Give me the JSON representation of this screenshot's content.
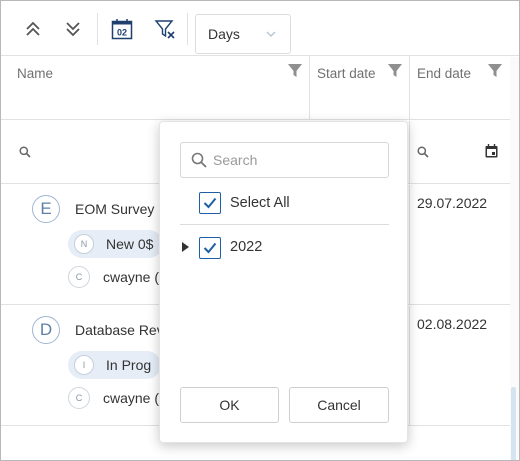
{
  "toolbar": {
    "collapse_all_icon": "double-chevron-up-icon",
    "expand_all_icon": "double-chevron-down-icon",
    "calendar_badge": "02",
    "clear_filter_icon": "filter-clear-icon",
    "scale_select": {
      "value": "Days"
    }
  },
  "columns": [
    {
      "label": "Name"
    },
    {
      "label": "Start date"
    },
    {
      "label": "End date"
    }
  ],
  "rows": [
    {
      "initial": "E",
      "title": "EOM Survey",
      "status_initial": "N",
      "status": "New 0$",
      "user_initial": "C",
      "user": "cwayne (",
      "end_date": "29.07.2022"
    },
    {
      "initial": "D",
      "title": "Database Rev",
      "status_initial": "I",
      "status": "In Prog",
      "user_initial": "C",
      "user": "cwayne (",
      "end_date": "02.08.2022"
    }
  ],
  "filter_popup": {
    "search_placeholder": "Search",
    "select_all_label": "Select All",
    "items": [
      {
        "label": "2022",
        "checked": true
      }
    ],
    "ok_label": "OK",
    "cancel_label": "Cancel"
  },
  "colors": {
    "accent": "#1f5fa6",
    "pill_bg": "#e6edf7",
    "icon_gray": "#8f8f8f"
  }
}
